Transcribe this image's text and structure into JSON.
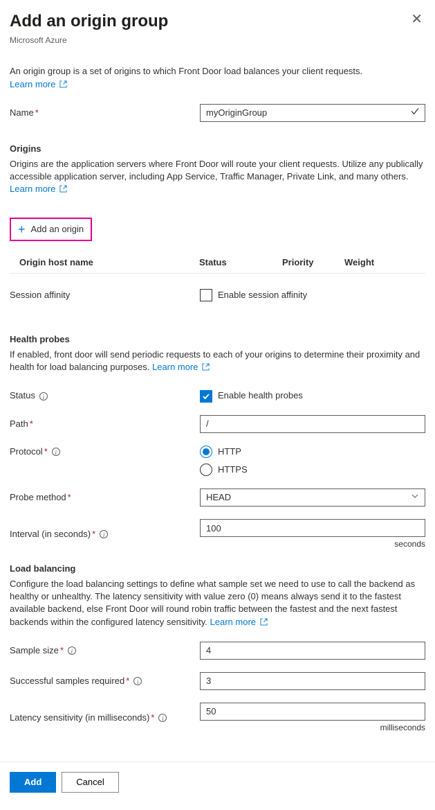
{
  "header": {
    "title": "Add an origin group",
    "subtitle": "Microsoft Azure"
  },
  "intro": {
    "text": "An origin group is a set of origins to which Front Door load balances your client requests.",
    "learn_more": "Learn more"
  },
  "name_field": {
    "label": "Name",
    "value": "myOriginGroup"
  },
  "origins": {
    "heading": "Origins",
    "desc_part1": "Origins are the application servers where Front Door will route your client requests. Utilize any publically accessible application server, including App Service, Traffic Manager, Private Link, and many others. ",
    "learn_more": "Learn more",
    "add_button": "Add an origin",
    "columns": {
      "host": "Origin host name",
      "status": "Status",
      "priority": "Priority",
      "weight": "Weight"
    }
  },
  "session_affinity": {
    "label": "Session affinity",
    "checkbox_label": "Enable session affinity"
  },
  "health_probes": {
    "heading": "Health probes",
    "desc": "If enabled, front door will send periodic requests to each of your origins to determine their proximity and health for load balancing purposes. ",
    "learn_more": "Learn more",
    "status_label": "Status",
    "status_checkbox": "Enable health probes",
    "path_label": "Path",
    "path_value": "/",
    "protocol_label": "Protocol",
    "protocol_http": "HTTP",
    "protocol_https": "HTTPS",
    "method_label": "Probe method",
    "method_value": "HEAD",
    "interval_label": "Interval (in seconds)",
    "interval_value": "100",
    "interval_unit": "seconds"
  },
  "load_balancing": {
    "heading": "Load balancing",
    "desc": "Configure the load balancing settings to define what sample set we need to use to call the backend as healthy or unhealthy. The latency sensitivity with value zero (0) means always send it to the fastest available backend, else Front Door will round robin traffic between the fastest and the next fastest backends within the configured latency sensitivity. ",
    "learn_more": "Learn more",
    "sample_label": "Sample size",
    "sample_value": "4",
    "success_label": "Successful samples required",
    "success_value": "3",
    "latency_label": "Latency sensitivity (in milliseconds)",
    "latency_value": "50",
    "latency_unit": "milliseconds"
  },
  "footer": {
    "add": "Add",
    "cancel": "Cancel"
  }
}
